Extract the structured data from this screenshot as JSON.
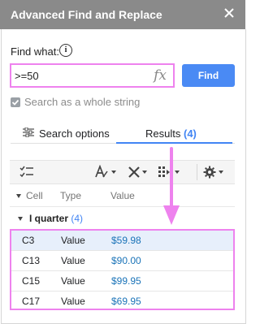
{
  "window": {
    "title": "Advanced Find and Replace"
  },
  "find": {
    "label": "Find what:",
    "value": ">=50",
    "formula_icon": "fx",
    "button": "Find"
  },
  "option": {
    "label": "Search as a whole string",
    "checked": true
  },
  "tabs": {
    "search": "Search options",
    "results_label": "Results",
    "results_count": "(4)"
  },
  "toolbar": {
    "icons": [
      "select-all-icon",
      "text-format-icon",
      "delete-icon",
      "replace-icon",
      "settings-icon"
    ]
  },
  "columns": {
    "cell": "Cell",
    "type": "Type",
    "value": "Value"
  },
  "group": {
    "name": "I quarter",
    "count": "(4)"
  },
  "rows": [
    {
      "cell": "C3",
      "type": "Value",
      "value": "$59.98"
    },
    {
      "cell": "C13",
      "type": "Value",
      "value": "$90.00"
    },
    {
      "cell": "C15",
      "type": "Value",
      "value": "$99.95"
    },
    {
      "cell": "C17",
      "type": "Value",
      "value": "$69.95"
    }
  ],
  "colors": {
    "accent": "#4285f4",
    "highlight": "#ee82ee",
    "titlebar": "#8a8a8a"
  }
}
